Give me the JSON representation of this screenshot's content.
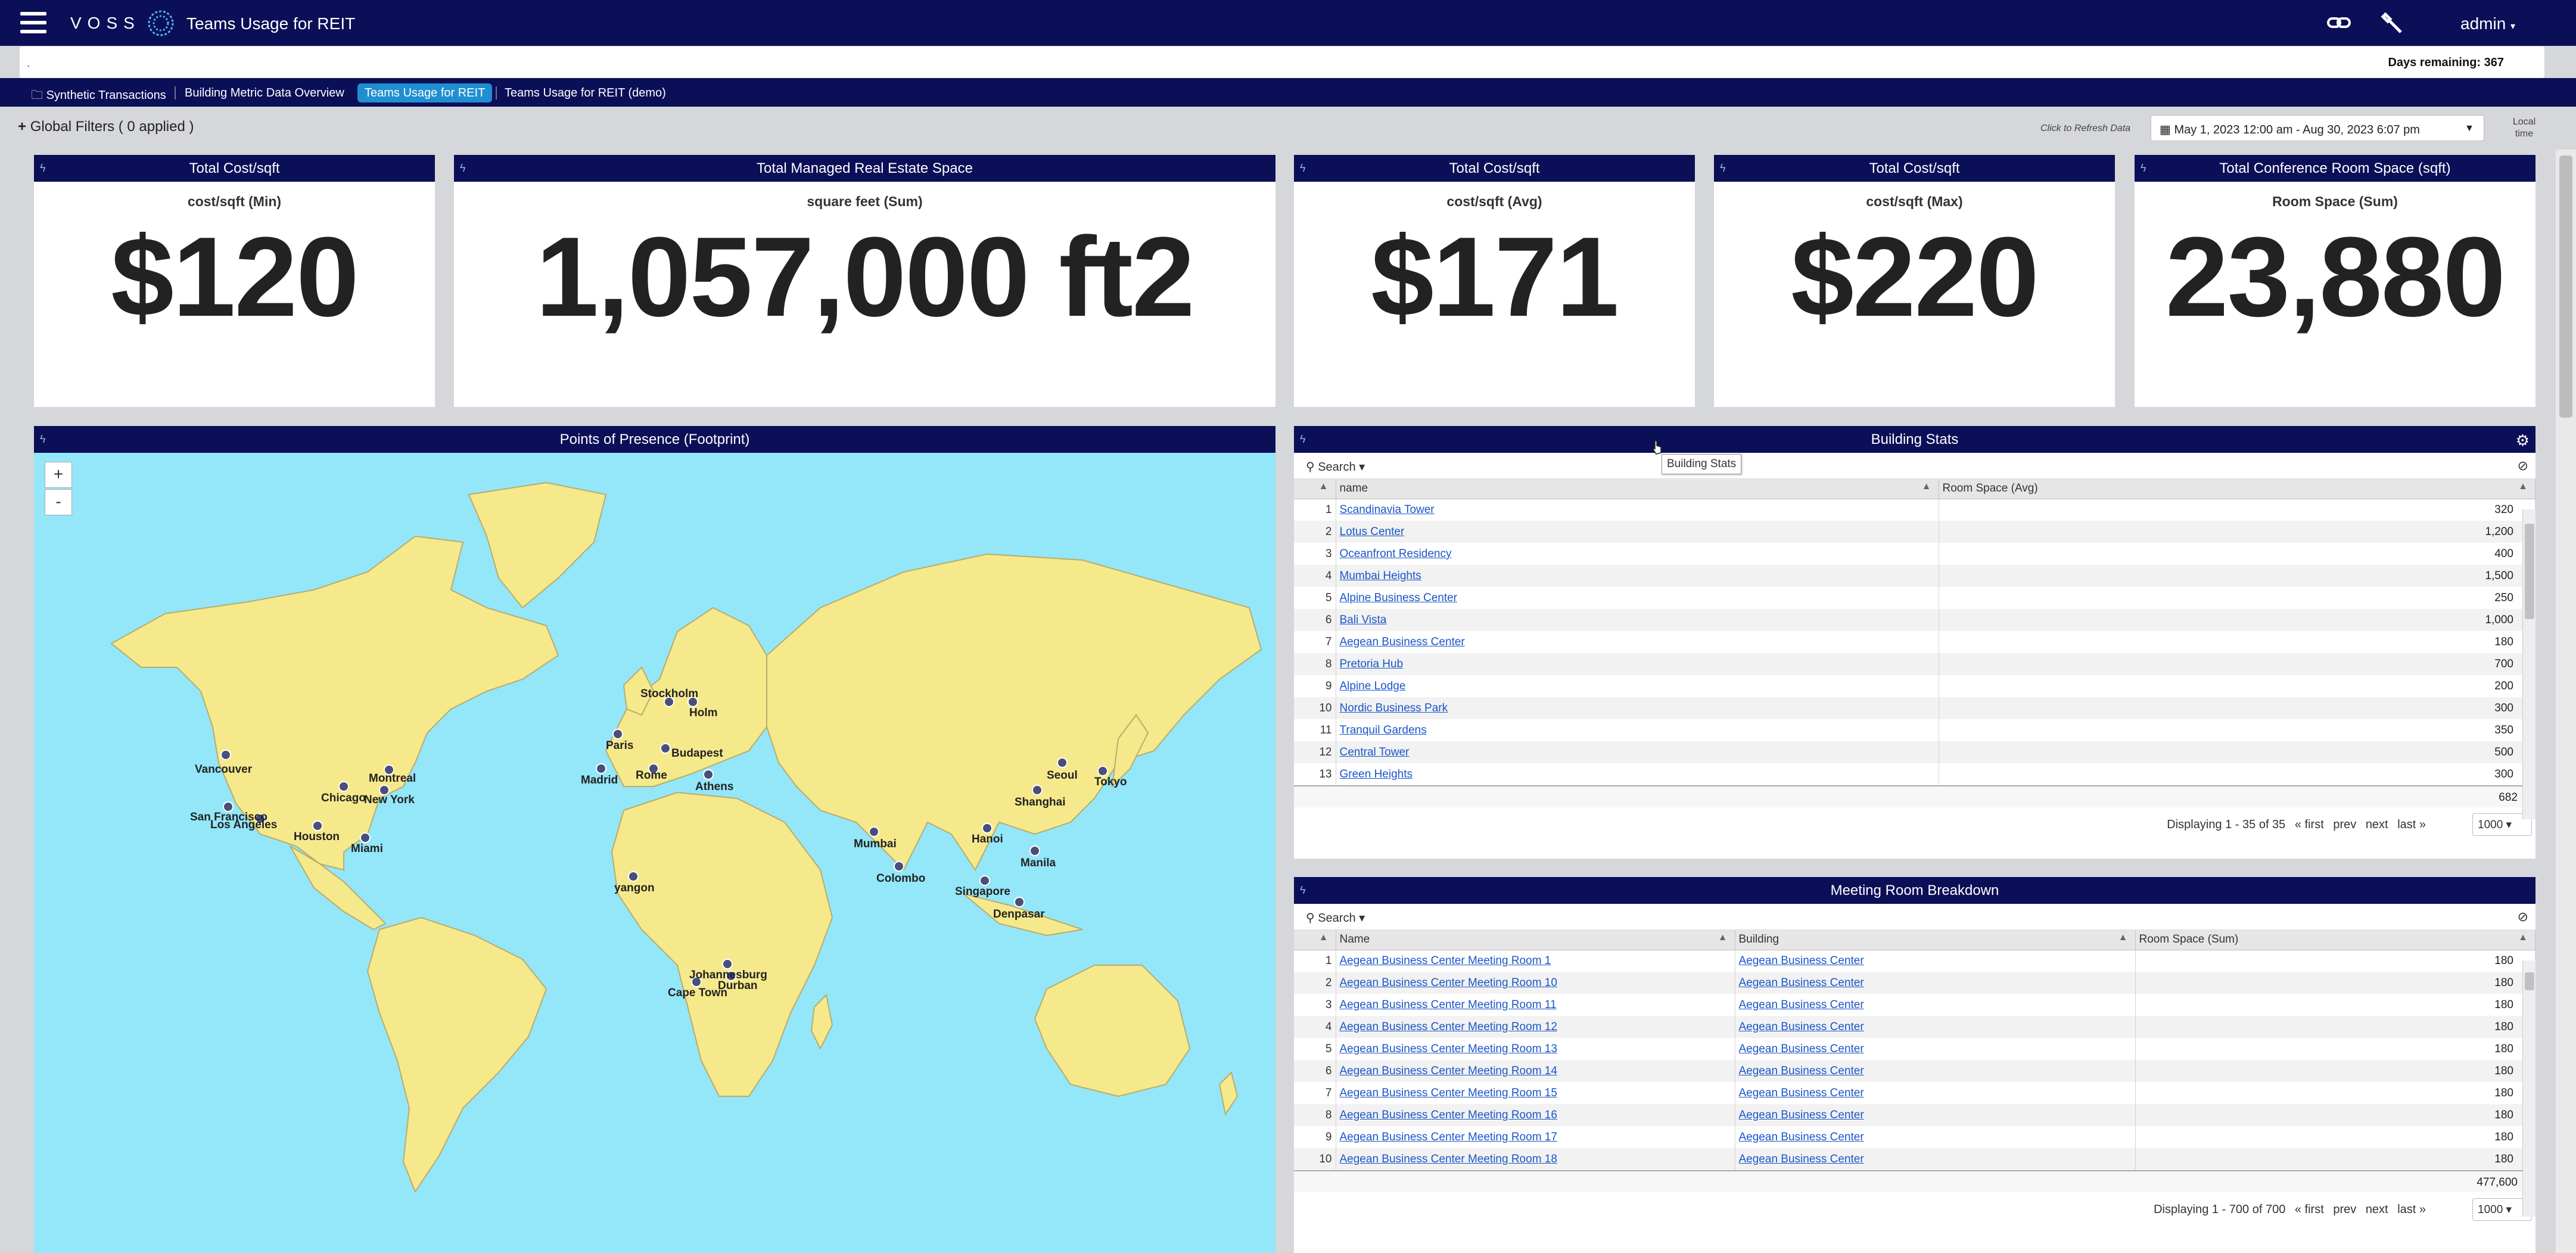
{
  "app": {
    "brand": "VOSS",
    "title": "Teams Usage for REIT",
    "user": "admin",
    "notice_mark": ".",
    "days_remaining": "Days remaining: 367"
  },
  "tabs": [
    {
      "label": "Synthetic Transactions",
      "folder": true
    },
    {
      "label": "Building Metric Data Overview"
    },
    {
      "label": "Teams Usage for REIT",
      "active": true
    },
    {
      "label": "Teams Usage for REIT (demo)"
    }
  ],
  "filters": {
    "global": "Global Filters ( 0 applied )",
    "refresh": "Click to Refresh Data",
    "date_range": "May 1, 2023 12:00 am - Aug 30, 2023 6:07 pm",
    "local_time_1": "Local",
    "local_time_2": "time"
  },
  "kpis": [
    {
      "title": "Total Cost/sqft",
      "subtitle": "cost/sqft (Min)",
      "value": "$120"
    },
    {
      "title": "Total Managed Real Estate Space",
      "subtitle": "square feet (Sum)",
      "value": "1,057,000 ft2"
    },
    {
      "title": "Total Cost/sqft",
      "subtitle": "cost/sqft (Avg)",
      "value": "$171"
    },
    {
      "title": "Total Cost/sqft",
      "subtitle": "cost/sqft (Max)",
      "value": "$220"
    },
    {
      "title": "Total Conference Room Space (sqft)",
      "subtitle": "Room Space (Sum)",
      "value": "23,880"
    }
  ],
  "map": {
    "title": "Points of Presence (Footprint)",
    "zoom_in": "+",
    "zoom_out": "-",
    "colors": {
      "ocean": "#94e6f9",
      "land": "#f6e98c",
      "border": "#b8ad6a",
      "marker": "#4a4e7a"
    },
    "cities": [
      "Vancouver",
      "Montreal",
      "Chicago",
      "New York",
      "San Francisco",
      "Los Angeles",
      "Houston",
      "Miami",
      "Stockholm",
      "Holm",
      "Paris",
      "Budapest",
      "Madrid",
      "Rome",
      "Athens",
      "Seoul",
      "Tokyo",
      "Shanghai",
      "Hanoi",
      "Manila",
      "Mumbai",
      "Colombo",
      "Singapore",
      "Denpasar",
      "yangon",
      "Johannesburg",
      "Durban",
      "Cape Town"
    ]
  },
  "building_stats": {
    "title": "Building Stats",
    "tooltip": "Building Stats",
    "search": "Search",
    "columns": [
      "name",
      "Room Space (Avg)"
    ],
    "rows": [
      {
        "n": "1",
        "name": "Scandinavia Tower",
        "value": "320"
      },
      {
        "n": "2",
        "name": "Lotus Center",
        "value": "1,200"
      },
      {
        "n": "3",
        "name": "Oceanfront Residency",
        "value": "400"
      },
      {
        "n": "4",
        "name": "Mumbai Heights",
        "value": "1,500"
      },
      {
        "n": "5",
        "name": "Alpine Business Center",
        "value": "250"
      },
      {
        "n": "6",
        "name": "Bali Vista",
        "value": "1,000"
      },
      {
        "n": "7",
        "name": "Aegean Business Center",
        "value": "180"
      },
      {
        "n": "8",
        "name": "Pretoria Hub",
        "value": "700"
      },
      {
        "n": "9",
        "name": "Alpine Lodge",
        "value": "200"
      },
      {
        "n": "10",
        "name": "Nordic Business Park",
        "value": "300"
      },
      {
        "n": "11",
        "name": "Tranquil Gardens",
        "value": "350"
      },
      {
        "n": "12",
        "name": "Central Tower",
        "value": "500"
      },
      {
        "n": "13",
        "name": "Green Heights",
        "value": "300"
      }
    ],
    "total": "682",
    "paging": "Displaying 1 - 35 of 35",
    "first": "« first",
    "prev": "prev",
    "next": "next",
    "last": "last »",
    "page_size": "1000"
  },
  "meeting_rooms": {
    "title": "Meeting Room Breakdown",
    "search": "Search",
    "columns": [
      "Name",
      "Building",
      "Room Space (Sum)"
    ],
    "rows": [
      {
        "n": "1",
        "name": "Aegean Business Center Meeting Room 1",
        "building": "Aegean Business Center",
        "value": "180"
      },
      {
        "n": "2",
        "name": "Aegean Business Center Meeting Room 10",
        "building": "Aegean Business Center",
        "value": "180"
      },
      {
        "n": "3",
        "name": "Aegean Business Center Meeting Room 11",
        "building": "Aegean Business Center",
        "value": "180"
      },
      {
        "n": "4",
        "name": "Aegean Business Center Meeting Room 12",
        "building": "Aegean Business Center",
        "value": "180"
      },
      {
        "n": "5",
        "name": "Aegean Business Center Meeting Room 13",
        "building": "Aegean Business Center",
        "value": "180"
      },
      {
        "n": "6",
        "name": "Aegean Business Center Meeting Room 14",
        "building": "Aegean Business Center",
        "value": "180"
      },
      {
        "n": "7",
        "name": "Aegean Business Center Meeting Room 15",
        "building": "Aegean Business Center",
        "value": "180"
      },
      {
        "n": "8",
        "name": "Aegean Business Center Meeting Room 16",
        "building": "Aegean Business Center",
        "value": "180"
      },
      {
        "n": "9",
        "name": "Aegean Business Center Meeting Room 17",
        "building": "Aegean Business Center",
        "value": "180"
      },
      {
        "n": "10",
        "name": "Aegean Business Center Meeting Room 18",
        "building": "Aegean Business Center",
        "value": "180"
      }
    ],
    "total": "477,600",
    "paging": "Displaying 1 - 700 of 700",
    "first": "« first",
    "prev": "prev",
    "next": "next",
    "last": "last »",
    "page_size": "1000"
  }
}
